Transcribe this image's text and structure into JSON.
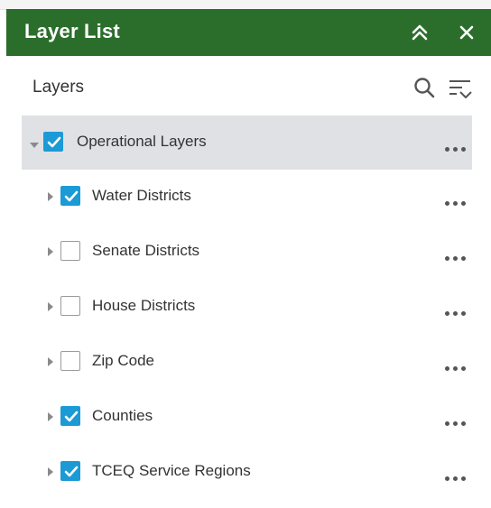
{
  "header": {
    "title": "Layer List",
    "collapse_icon": "chevron-double-up-icon",
    "close_icon": "close-icon",
    "background_color": "#2b6e2c"
  },
  "toolbar": {
    "title": "Layers",
    "search_icon": "search-icon",
    "filter_icon": "filter-list-icon"
  },
  "layers": {
    "group": {
      "label": "Operational Layers",
      "checked": true,
      "expanded": true
    },
    "items": [
      {
        "label": "Water Districts",
        "checked": true
      },
      {
        "label": "Senate Districts",
        "checked": false
      },
      {
        "label": "House Districts",
        "checked": false
      },
      {
        "label": "Zip Code",
        "checked": false
      },
      {
        "label": "Counties",
        "checked": true
      },
      {
        "label": "TCEQ Service Regions",
        "checked": true
      }
    ]
  },
  "colors": {
    "checkbox_checked": "#1b9ad6",
    "group_row_background": "#dfe1e5",
    "text": "#333333"
  }
}
